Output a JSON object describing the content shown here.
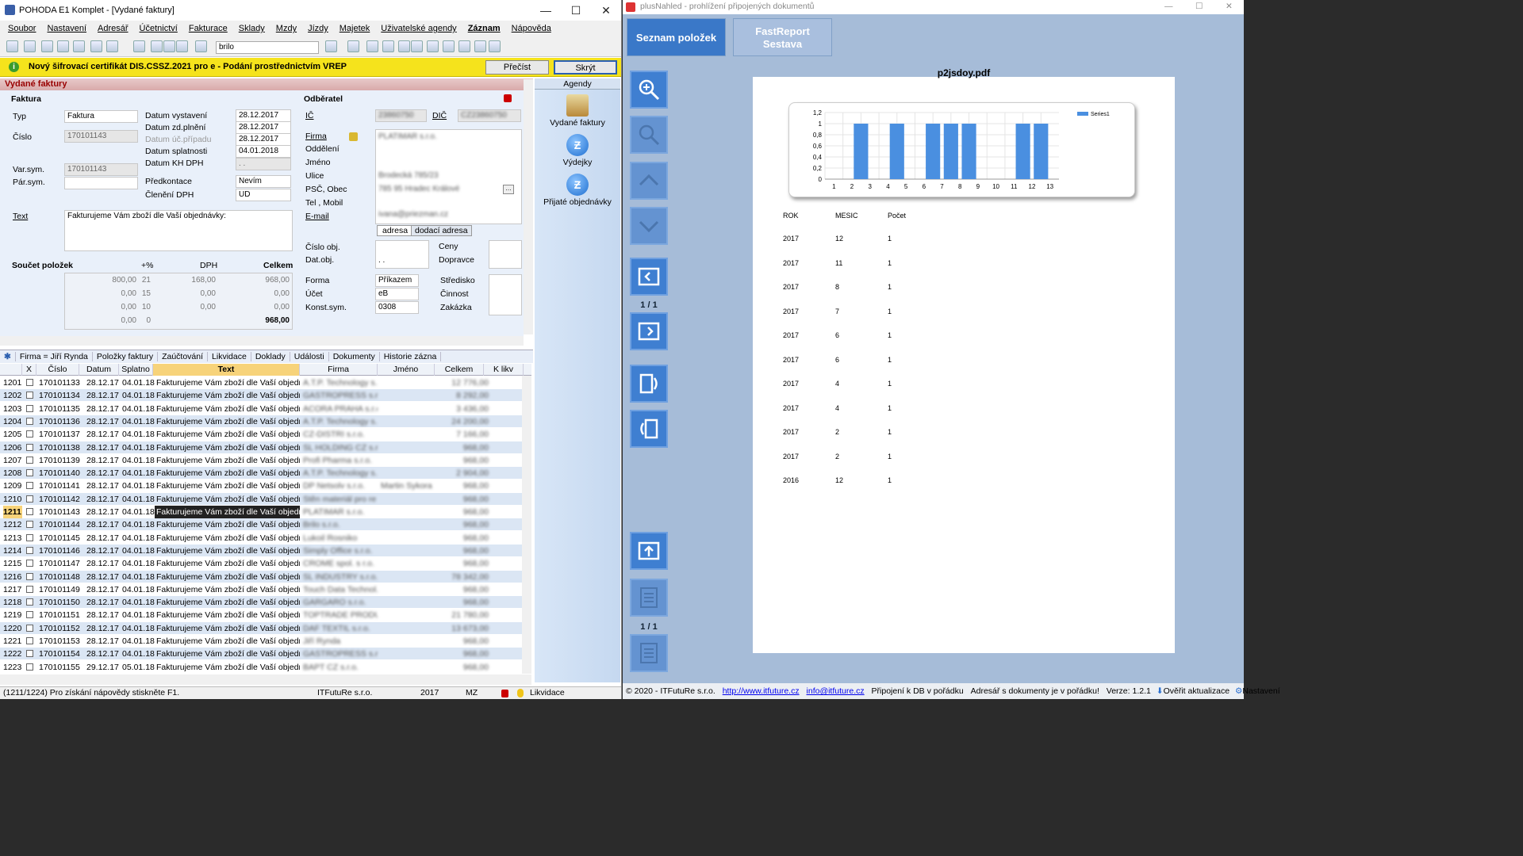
{
  "left_window": {
    "title": "POHODA E1 Komplet - [Vydané faktury]",
    "menu": [
      "Soubor",
      "Nastavení",
      "Adresář",
      "Účetnictví",
      "Fakturace",
      "Sklady",
      "Mzdy",
      "Jízdy",
      "Majetek",
      "Uživatelské agendy",
      "Záznam",
      "Nápověda"
    ],
    "toolbar_combo": "brilo",
    "notification": {
      "text": "Nový šifrovací certifikát DIS.CSSZ.2021 pro e - Podání prostřednictvím VREP",
      "read_label": "Přečíst",
      "hide_label": "Skrýt"
    },
    "agenda_title": "Vydané faktury",
    "form": {
      "section_invoice": "Faktura",
      "typ_label": "Typ",
      "typ_value": "Faktura",
      "cislo_label": "Číslo",
      "cislo_value": "170101143",
      "varsym_label": "Var.sym.",
      "varsym_value": "170101143",
      "parsym_label": "Pár.sym.",
      "text_label": "Text",
      "text_value": "Fakturujeme Vám zboží dle Vaší objednávky:",
      "dates": [
        {
          "label": "Datum vystavení",
          "value": "28.12.2017"
        },
        {
          "label": "Datum zd.plnění",
          "value": "28.12.2017"
        },
        {
          "label": "Datum úč.případu",
          "value": "28.12.2017"
        },
        {
          "label": "Datum splatnosti",
          "value": "04.01.2018"
        },
        {
          "label": "Datum KH DPH",
          "value": ". ."
        }
      ],
      "predkontace_label": "Předkontace",
      "predkontace_value": "Nevím",
      "cleneni_label": "Členění DPH",
      "cleneni_value": "UD",
      "section_customer": "Odběratel",
      "ic_label": "IČ",
      "dic_label": "DIČ",
      "customer_labels": [
        "Firma",
        "Oddělení",
        "Jméno",
        "Ulice",
        "PSČ, Obec",
        "Tel , Mobil",
        "E-mail"
      ],
      "customer_blurred": [
        "PLATIMAR s.r.o.",
        "Brodecká 785/23",
        "785 95  Hradec Králové",
        "ivana@priezman.cz"
      ],
      "address_tabs": [
        "adresa",
        "dodací adresa"
      ],
      "cislo_obj_label": "Číslo obj.",
      "dat_obj_label": "Dat.obj.",
      "dat_obj_value": ". .",
      "ceny_label": "Ceny",
      "dopravce_label": "Dopravce",
      "sum_title": "Součet položek",
      "sum_pct": "+%",
      "sum_dph": "DPH",
      "sum_celkem": "Celkem",
      "sum_rows": [
        {
          "base": "800,00",
          "pct": "21",
          "dph": "168,00",
          "total": "968,00"
        },
        {
          "base": "0,00",
          "pct": "15",
          "dph": "0,00",
          "total": "0,00"
        },
        {
          "base": "0,00",
          "pct": "10",
          "dph": "0,00",
          "total": "0,00"
        },
        {
          "base": "0,00",
          "pct": "0",
          "dph": "",
          "total": "968,00"
        }
      ],
      "forma_label": "Forma",
      "forma_value": "Příkazem",
      "ucet_label": "Účet",
      "ucet_value": "eB",
      "konst_label": "Konst.sym.",
      "konst_value": "0308",
      "stredisko_label": "Středisko",
      "cinnost_label": "Činnost",
      "zakazka_label": "Zakázka"
    },
    "agendas": {
      "header": "Agendy",
      "items": [
        "Vydané faktury",
        "Výdejky",
        "Přijaté objednávky"
      ]
    },
    "tabs": [
      "Firma = Jiří Rynda",
      "Položky faktury",
      "Zaúčtování",
      "Likvidace",
      "Doklady",
      "Události",
      "Dokumenty",
      "Historie zázna"
    ],
    "grid": {
      "columns": [
        "X",
        "Číslo",
        "Datum",
        "Splatno",
        "Text",
        "Firma",
        "Jméno",
        "Celkem",
        "K likv"
      ],
      "rows": [
        {
          "n": "1201",
          "cislo": "170101133",
          "datum": "28.12.17",
          "splatno": "04.01.18",
          "text": "Fakturujeme Vám zboží dle Vaší objednáv",
          "firma": "A.T.P. Technology s.r.o.",
          "celkem": "12 776,00"
        },
        {
          "n": "1202",
          "cislo": "170101134",
          "datum": "28.12.17",
          "splatno": "04.01.18",
          "text": "Fakturujeme Vám zboží dle Vaší objednáv",
          "firma": "GASTROPRESS s.r.o.",
          "celkem": "8 292,00"
        },
        {
          "n": "1203",
          "cislo": "170101135",
          "datum": "28.12.17",
          "splatno": "04.01.18",
          "text": "Fakturujeme Vám zboží dle Vaší objednáv",
          "firma": "ACORA PRAHA s.r.o.",
          "celkem": "3 436,00"
        },
        {
          "n": "1204",
          "cislo": "170101136",
          "datum": "28.12.17",
          "splatno": "04.01.18",
          "text": "Fakturujeme Vám zboží dle Vaší objednáv",
          "firma": "A.T.P. Technology s.r.o.",
          "celkem": "24 200,00"
        },
        {
          "n": "1205",
          "cislo": "170101137",
          "datum": "28.12.17",
          "splatno": "04.01.18",
          "text": "Fakturujeme Vám zboží dle Vaší objednáv",
          "firma": "CZ-DISTRI s.r.o.",
          "celkem": "7 166,00"
        },
        {
          "n": "1206",
          "cislo": "170101138",
          "datum": "28.12.17",
          "splatno": "04.01.18",
          "text": "Fakturujeme Vám zboží dle Vaší objednáv",
          "firma": "SL HOLDING CZ s.r.o.",
          "celkem": "968,00"
        },
        {
          "n": "1207",
          "cislo": "170101139",
          "datum": "28.12.17",
          "splatno": "04.01.18",
          "text": "Fakturujeme Vám zboží dle Vaší objednáv",
          "firma": "Profi Pharma s.r.o.",
          "celkem": "968,00"
        },
        {
          "n": "1208",
          "cislo": "170101140",
          "datum": "28.12.17",
          "splatno": "04.01.18",
          "text": "Fakturujeme Vám zboží dle Vaší objednáv",
          "firma": "A.T.P. Technology s.r.o.",
          "celkem": "2 904,00"
        },
        {
          "n": "1209",
          "cislo": "170101141",
          "datum": "28.12.17",
          "splatno": "04.01.18",
          "text": "Fakturujeme Vám zboží dle Vaší objednáv",
          "firma": "DP Netsolv s.r.o.",
          "jmeno": "Martin Sykora",
          "celkem": "968,00"
        },
        {
          "n": "1210",
          "cislo": "170101142",
          "datum": "28.12.17",
          "splatno": "04.01.18",
          "text": "Fakturujeme Vám zboží dle Vaší objednáv",
          "firma": "Stěn materiál pro re",
          "celkem": "968,00"
        },
        {
          "n": "1211",
          "cislo": "170101143",
          "datum": "28.12.17",
          "splatno": "04.01.18",
          "text": "Fakturujeme Vám zboží dle Vaší objednáv",
          "firma": "PLATIMAR s.r.o.",
          "celkem": "968,00",
          "selected": true
        },
        {
          "n": "1212",
          "cislo": "170101144",
          "datum": "28.12.17",
          "splatno": "04.01.18",
          "text": "Fakturujeme Vám zboží dle Vaší objednáv",
          "firma": "Brilo s.r.o.",
          "celkem": "968,00"
        },
        {
          "n": "1213",
          "cislo": "170101145",
          "datum": "28.12.17",
          "splatno": "04.01.18",
          "text": "Fakturujeme Vám zboží dle Vaší objednáv",
          "firma": "Lukoil Rosniko",
          "celkem": "968,00"
        },
        {
          "n": "1214",
          "cislo": "170101146",
          "datum": "28.12.17",
          "splatno": "04.01.18",
          "text": "Fakturujeme Vám zboží dle Vaší objednáv",
          "firma": "Simply Office s.r.o.",
          "celkem": "968,00"
        },
        {
          "n": "1215",
          "cislo": "170101147",
          "datum": "28.12.17",
          "splatno": "04.01.18",
          "text": "Fakturujeme Vám zboží dle Vaší objednáv",
          "firma": "CROME spol. s r.o.",
          "celkem": "968,00"
        },
        {
          "n": "1216",
          "cislo": "170101148",
          "datum": "28.12.17",
          "splatno": "04.01.18",
          "text": "Fakturujeme Vám zboží dle Vaší objednáv",
          "firma": "SL INDUSTRY s.r.o.",
          "celkem": "78 342,00"
        },
        {
          "n": "1217",
          "cislo": "170101149",
          "datum": "28.12.17",
          "splatno": "04.01.18",
          "text": "Fakturujeme Vám zboží dle Vaší objednáv",
          "firma": "Touch Data Technol.",
          "celkem": "968,00"
        },
        {
          "n": "1218",
          "cislo": "170101150",
          "datum": "28.12.17",
          "splatno": "04.01.18",
          "text": "Fakturujeme Vám zboží dle Vaší objednáv",
          "firma": "GARGARO s.r.o.",
          "celkem": "968,00"
        },
        {
          "n": "1219",
          "cislo": "170101151",
          "datum": "28.12.17",
          "splatno": "04.01.18",
          "text": "Fakturujeme Vám zboží dle Vaší objednáv",
          "firma": "TOPTRADE PRODUC",
          "celkem": "21 780,00"
        },
        {
          "n": "1220",
          "cislo": "170101152",
          "datum": "28.12.17",
          "splatno": "04.01.18",
          "text": "Fakturujeme Vám zboží dle Vaší objednáv",
          "firma": "DAF TEXTIL s.r.o.",
          "celkem": "13 673,00"
        },
        {
          "n": "1221",
          "cislo": "170101153",
          "datum": "28.12.17",
          "splatno": "04.01.18",
          "text": "Fakturujeme Vám zboží dle Vaší objednáv",
          "firma": "Jiří Rynda",
          "celkem": "968,00"
        },
        {
          "n": "1222",
          "cislo": "170101154",
          "datum": "28.12.17",
          "splatno": "04.01.18",
          "text": "Fakturujeme Vám zboží dle Vaší objednáv",
          "firma": "GASTROPRESS s.r.o.",
          "celkem": "968,00"
        },
        {
          "n": "1223",
          "cislo": "170101155",
          "datum": "29.12.17",
          "splatno": "05.01.18",
          "text": "Fakturujeme Vám zboží dle Vaší objednáv",
          "firma": "BAPT CZ s.r.o.",
          "celkem": "968,00"
        }
      ]
    },
    "status": {
      "left": "(1211/1224) Pro získání nápovědy stiskněte F1.",
      "company": "ITFutuRe s.r.o.",
      "year": "2017",
      "user": "MZ",
      "mode": "Likvidace"
    }
  },
  "right_window": {
    "title": "plusNahled - prohlížení připojených dokumentů",
    "btn_list": "Seznam položek",
    "btn_fastreport": "FastReport\nSestava",
    "page_indicator_top": "1 / 1",
    "page_indicator_bottom": "1 / 1",
    "doc_title": "p2jsdoy.pdf",
    "table_headers": [
      "ROK",
      "MESIC",
      "Počet"
    ],
    "table_rows": [
      [
        "2017",
        "12",
        "1"
      ],
      [
        "2017",
        "11",
        "1"
      ],
      [
        "2017",
        "8",
        "1"
      ],
      [
        "2017",
        "7",
        "1"
      ],
      [
        "2017",
        "6",
        "1"
      ],
      [
        "2017",
        "6",
        "1"
      ],
      [
        "2017",
        "4",
        "1"
      ],
      [
        "2017",
        "4",
        "1"
      ],
      [
        "2017",
        "2",
        "1"
      ],
      [
        "2017",
        "2",
        "1"
      ],
      [
        "2016",
        "12",
        "1"
      ]
    ],
    "status": {
      "copyright": "© 2020 - ITFutuRe s.r.o.",
      "web": "http://www.itfuture.cz",
      "email": "info@itfuture.cz",
      "db": "Připojení k DB v pořádku",
      "adresar": "Adresář s dokumenty je v pořádku!",
      "version": "Verze: 1.2.1",
      "update": "Ověřit aktualizace",
      "settings": "Nastavení"
    }
  },
  "chart_data": {
    "type": "bar",
    "categories": [
      "1",
      "2",
      "3",
      "4",
      "5",
      "6",
      "7",
      "8",
      "9",
      "10",
      "11",
      "12",
      "13"
    ],
    "series": [
      {
        "name": "Series1",
        "values": [
          0,
          1,
          0,
          1,
          0,
          1,
          1,
          1,
          0,
          0,
          1,
          1,
          0
        ]
      }
    ],
    "ylim": [
      0,
      1.2
    ],
    "yticks": [
      "0",
      "0,2",
      "0,4",
      "0,6",
      "0,8",
      "1",
      "1,2"
    ],
    "legend": "top-right",
    "grid": true,
    "bar_color": "#4a8fe0"
  }
}
